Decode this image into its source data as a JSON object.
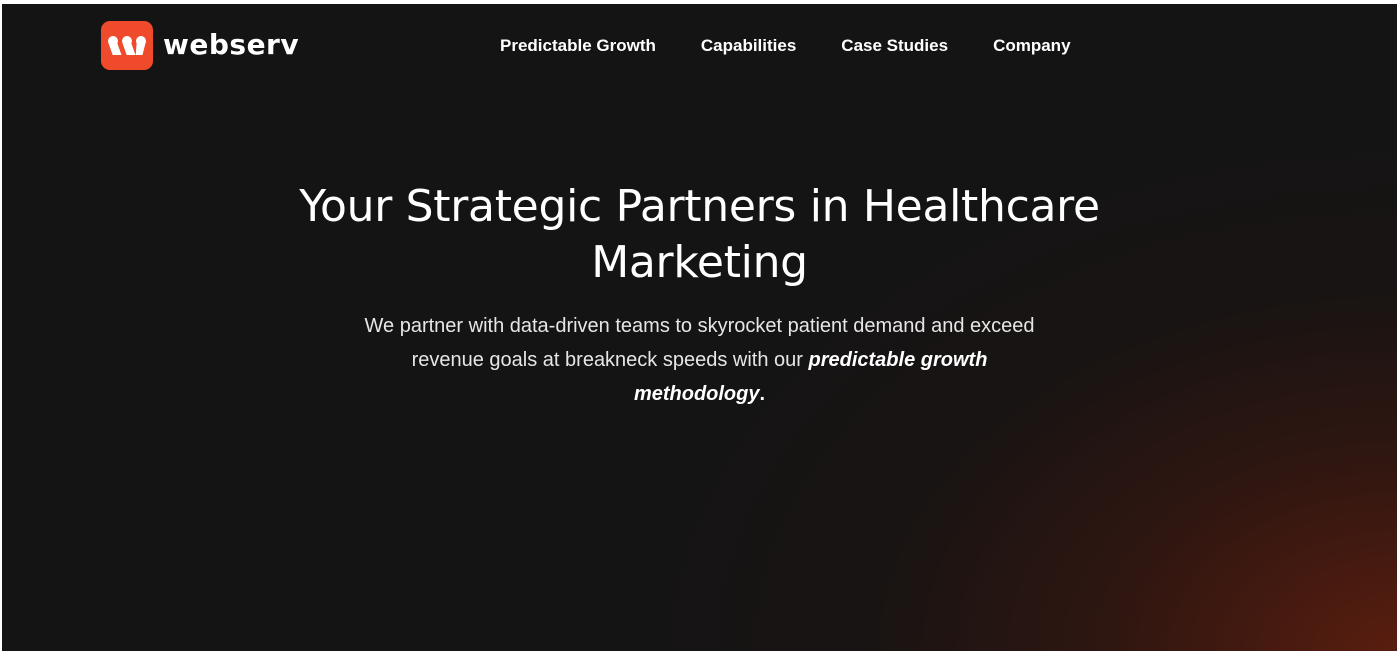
{
  "brand": {
    "name": "webserv",
    "logo_color": "#ee4a2b",
    "logo_icon": "webserv-logo-mark-icon"
  },
  "nav": {
    "items": [
      {
        "label": "Predictable Growth"
      },
      {
        "label": "Capabilities"
      },
      {
        "label": "Case Studies"
      },
      {
        "label": "Company"
      }
    ]
  },
  "hero": {
    "title_line1": "Your Strategic Partners in Healthcare",
    "title_line2": "Marketing",
    "subtitle_line1": "We partner with data-driven teams to skyrocket patient demand and exceed",
    "subtitle_line2_plain": "revenue goals at breakneck speeds with our ",
    "subtitle_line2_emphasis": "predictable growth",
    "subtitle_line3_emphasis": "methodology",
    "subtitle_line3_end": "."
  },
  "colors": {
    "background": "#141414",
    "glow": "#601e0e",
    "text": "#ffffff"
  }
}
